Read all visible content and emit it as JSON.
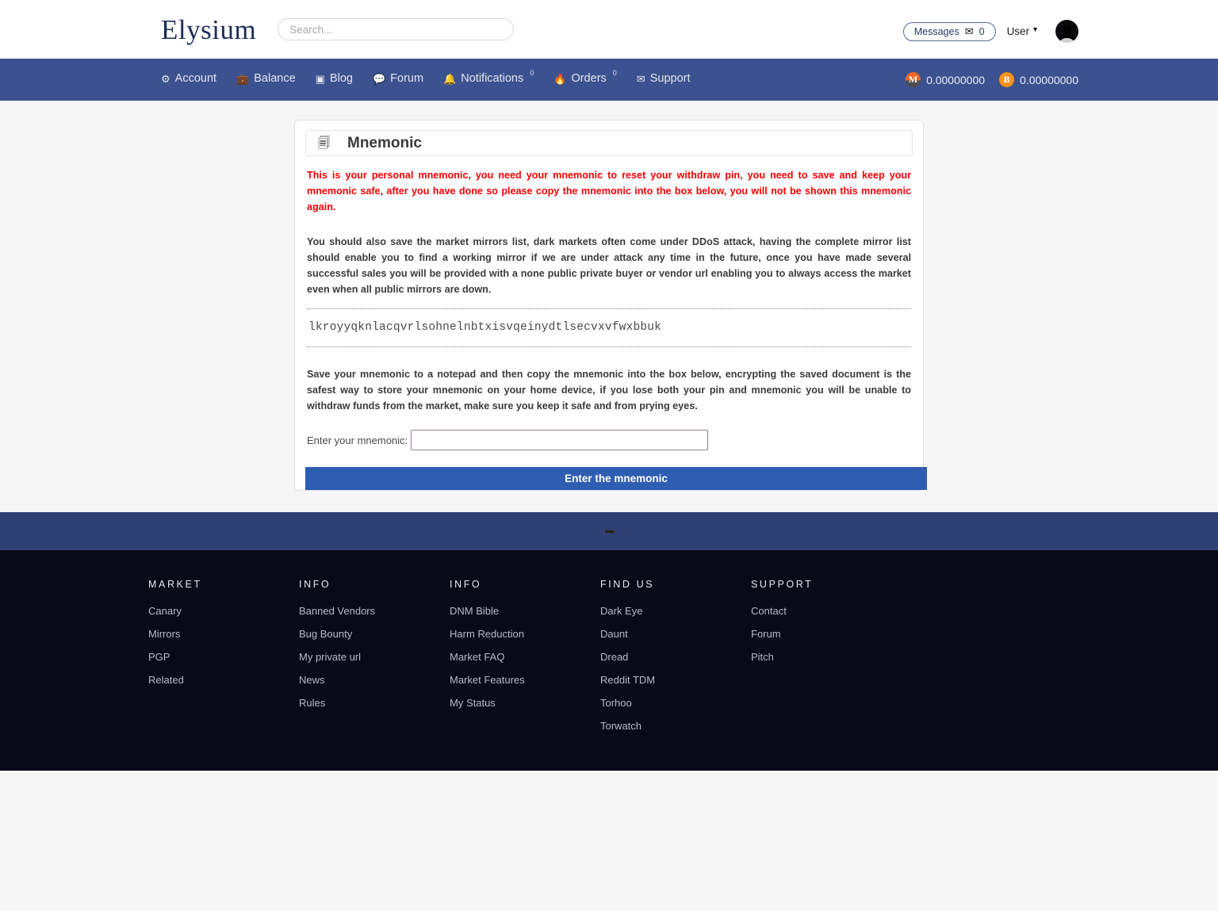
{
  "header": {
    "brand": "Elysium",
    "search_placeholder": "Search...",
    "search_value": "",
    "messages_label": "Messages",
    "messages_icon": "envelope-icon",
    "messages_count": "0",
    "user_label": "User",
    "chevron": "∨",
    "avatar": "user-avatar"
  },
  "nav": {
    "items": [
      {
        "label": "Account",
        "icon": "⚙",
        "icon_name": "gear-icon",
        "sup": ""
      },
      {
        "label": "Balance",
        "icon": "💼",
        "icon_name": "briefcase-icon",
        "sup": ""
      },
      {
        "label": "Blog",
        "icon": "◰",
        "icon_name": "blog-icon",
        "sup": ""
      },
      {
        "label": "Forum",
        "icon": "💬",
        "icon_name": "speech-bubble-icon",
        "sup": ""
      },
      {
        "label": "Notifications",
        "icon": "🔔",
        "icon_name": "bell-icon",
        "sup": "0"
      },
      {
        "label": "Orders",
        "icon": "🔥",
        "icon_name": "flame-icon",
        "sup": "0"
      },
      {
        "label": "Support",
        "icon": "✉",
        "icon_name": "envelope-icon",
        "sup": ""
      }
    ],
    "wallets": [
      {
        "coin": "XMR",
        "symbol": "M",
        "amount": "0.00000000"
      },
      {
        "coin": "BTC",
        "symbol": "Ƀ",
        "amount": "0.00000000"
      }
    ]
  },
  "card": {
    "icon": "🗐",
    "icon_name": "clone-icon",
    "title": "Mnemonic",
    "warning": "This is your personal mnemonic, you need your mnemonic to reset your withdraw pin, you need to save and keep your mnemonic safe, after you have done so please copy the mnemonic into the box below, you will not be shown this mnemonic again.",
    "info_paragraph": "You should also save the market mirrors list, dark markets often come under DDoS attack, having the complete mirror list should enable you to find a working mirror if we are under attack any time in the future, once you have made several successful sales you will be provided with a none public private buyer or vendor url enabling you to always access the market even when all public mirrors are down.",
    "mnemonic": "lkroyyqknlacqvrlsohnelnbtxisvqeinydtlsecvxvfwxbbuk",
    "save_paragraph": "Save your mnemonic to a notepad and then copy the mnemonic into the box below, encrypting the saved document is the safest way to store your mnemonic on your home device, if you lose both your pin and mnemonic you will be unable to withdraw funds from the market, make sure you keep it safe and from prying eyes.",
    "input_label": "Enter your mnemonic:",
    "input_value": "",
    "input_placeholder": "",
    "submit_label": "Enter the mnemonic"
  },
  "footer": {
    "columns": [
      {
        "heading": "MARKET",
        "links": [
          "Canary",
          "Mirrors",
          "PGP",
          "Related"
        ]
      },
      {
        "heading": "INFO",
        "links": [
          "Banned Vendors",
          "Bug Bounty",
          "My private url",
          "News",
          "Rules"
        ]
      },
      {
        "heading": "INFO",
        "links": [
          "DNM Bible",
          "Harm Reduction",
          "Market FAQ",
          "Market Features",
          "My Status"
        ]
      },
      {
        "heading": "FIND US",
        "links": [
          "Dark Eye",
          "Daunt",
          "Dread",
          "Reddit TDM",
          "Torhoo",
          "Torwatch"
        ]
      },
      {
        "heading": "SUPPORT",
        "links": [
          "Contact",
          "Forum",
          "Pitch"
        ]
      }
    ]
  },
  "colors": {
    "navbar": "#3b5190",
    "band": "#2f4073",
    "footer": "#080a18",
    "accent_button": "#2e5db2",
    "warning_text": "#ff0000",
    "brand_text": "#1c2d56"
  }
}
